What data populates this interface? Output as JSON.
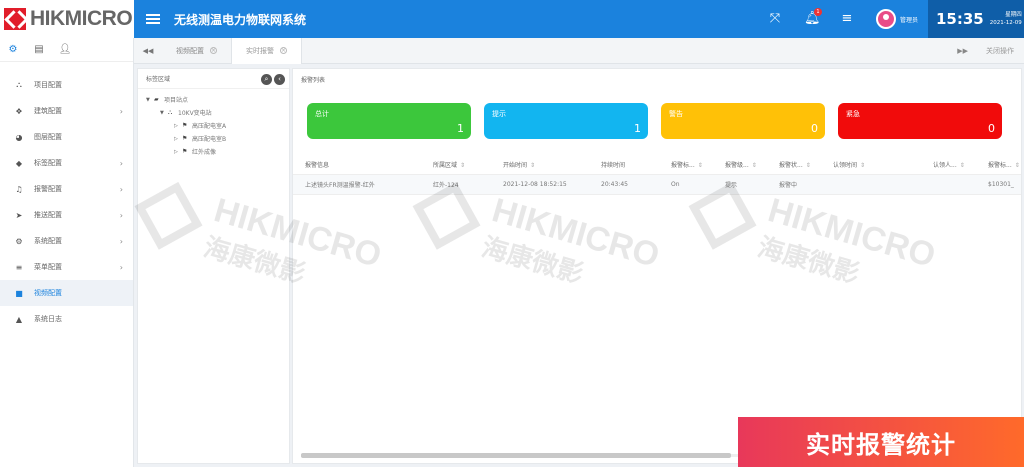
{
  "brand": {
    "logo_text": "HIKMICRO"
  },
  "header": {
    "title": "无线测温电力物联网系统",
    "notification_count": "1",
    "user_name": "管理员",
    "time": "15:35",
    "weekday": "星期四",
    "date": "2021-12-09"
  },
  "sidebar": {
    "items": [
      {
        "label": "项目配置",
        "icon": "sitemap-icon",
        "chevron": false
      },
      {
        "label": "建筑配置",
        "icon": "cubes-icon",
        "chevron": true
      },
      {
        "label": "图层配置",
        "icon": "pie-icon",
        "chevron": false
      },
      {
        "label": "标签配置",
        "icon": "tag-icon",
        "chevron": true
      },
      {
        "label": "报警配置",
        "icon": "bell-icon",
        "chevron": true
      },
      {
        "label": "推送配置",
        "icon": "send-icon",
        "chevron": true
      },
      {
        "label": "系统配置",
        "icon": "cogs-icon",
        "chevron": true
      },
      {
        "label": "菜单配置",
        "icon": "list-icon",
        "chevron": true
      },
      {
        "label": "视频配置",
        "icon": "video-icon",
        "chevron": false,
        "active": true
      },
      {
        "label": "系统日志",
        "icon": "warning-icon",
        "chevron": false
      }
    ]
  },
  "tabs": {
    "items": [
      {
        "label": "视频配置"
      },
      {
        "label": "实时报警"
      }
    ],
    "close_ops": "关闭操作"
  },
  "tree": {
    "title": "标签区域",
    "nodes": [
      {
        "label": "项目站点",
        "level": 0
      },
      {
        "label": "10KV变电站",
        "level": 1
      },
      {
        "label": "高压配电室A",
        "level": 2
      },
      {
        "label": "高压配电室B",
        "level": 2
      },
      {
        "label": "红外成像",
        "level": 2
      }
    ]
  },
  "alarms": {
    "title": "报警列表",
    "cards": [
      {
        "label": "总计",
        "value": "1",
        "color": "#3cc73c"
      },
      {
        "label": "提示",
        "value": "1",
        "color": "#12b5f0"
      },
      {
        "label": "警告",
        "value": "0",
        "color": "#ffc107"
      },
      {
        "label": "紧急",
        "value": "0",
        "color": "#f10b0b"
      }
    ],
    "columns": [
      "报警信息",
      "所属区域",
      "开始时间",
      "持续时间",
      "报警标...",
      "报警级...",
      "报警状...",
      "认领时间",
      "认领人...",
      "报警标..."
    ],
    "rows": [
      [
        "上述镜头FR测温报警-红外",
        "红外-124",
        "2021-12-08 18:52:15",
        "20:43:45",
        "On",
        "提示",
        "报警中",
        "",
        "",
        "$10301_"
      ]
    ]
  },
  "watermark": {
    "text": "HIKMICRO",
    "sub": "海康微影"
  },
  "banner": {
    "text": "实时报警统计"
  }
}
